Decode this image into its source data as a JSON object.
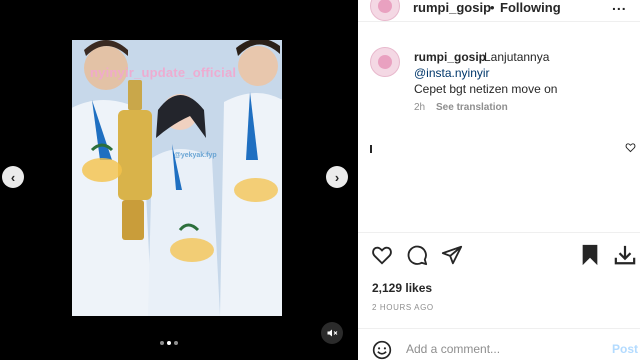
{
  "post": {
    "username": "rumpi_gosip",
    "separator": "•",
    "follow_label": "Following",
    "more_label": "...",
    "caption": {
      "username": "rumpi_gosip",
      "text_line1": "Lanjutannya",
      "mention": "@insta.nyinyir",
      "text_line2": "Cepet bgt netizen move on",
      "time": "2h",
      "translate_label": "See translation"
    },
    "likes": "2,129 likes",
    "posted_ago": "2 HOURS AGO",
    "comment_placeholder": "Add a comment...",
    "post_label": "Post"
  },
  "media": {
    "overlay_text": "nyinyir_update_official",
    "tag_text": "@yekyak.fyp",
    "carousel": {
      "count": 3,
      "active": 2
    }
  },
  "colors": {
    "link": "#00376b",
    "muted": "#8e8e8e",
    "text": "#262626",
    "post_disabled": "#b3dbff"
  }
}
